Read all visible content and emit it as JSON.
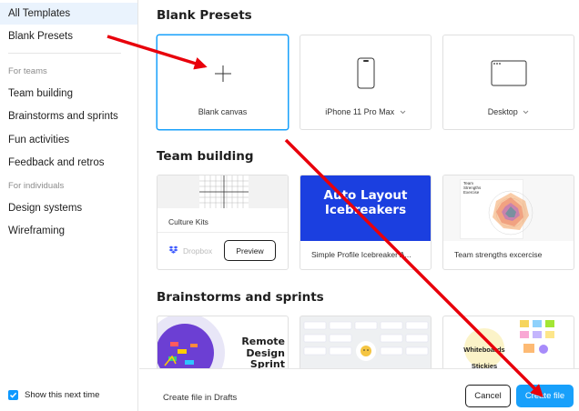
{
  "sidebar": {
    "items": [
      {
        "label": "All Templates"
      },
      {
        "label": "Blank Presets"
      }
    ],
    "section_teams": "For teams",
    "team_items": [
      {
        "label": "Team building"
      },
      {
        "label": "Brainstorms and sprints"
      },
      {
        "label": "Fun activities"
      },
      {
        "label": "Feedback and retros"
      }
    ],
    "section_individuals": "For individuals",
    "individual_items": [
      {
        "label": "Design systems"
      },
      {
        "label": "Wireframing"
      }
    ],
    "show_next_label": "Show this next time",
    "show_next_checked": true
  },
  "main": {
    "blank_presets": {
      "title": "Blank Presets",
      "cards": [
        {
          "label": "Blank canvas"
        },
        {
          "label": "iPhone 11 Pro Max"
        },
        {
          "label": "Desktop"
        }
      ]
    },
    "team_building": {
      "title": "Team building",
      "cards": [
        {
          "label": "Culture Kits",
          "source": "Dropbox",
          "action": "Preview"
        },
        {
          "label": "Simple Profile Icebreaker A...",
          "banner_line1": "Auto Layout",
          "banner_line2": "Icebreakers"
        },
        {
          "label": "Team strengths excercise",
          "mini_title": "Team Strengths Exercise"
        }
      ]
    },
    "brainstorms": {
      "title": "Brainstorms and sprints",
      "cards": [
        {
          "banner_line1": "Remote",
          "banner_line2": "Design",
          "banner_line3": "Sprint"
        },
        {},
        {
          "banner_line1": "Whiteboards",
          "banner_line2": "Stickies"
        }
      ]
    }
  },
  "footer": {
    "label": "Create file in Drafts",
    "cancel": "Cancel",
    "create": "Create file"
  },
  "colors": {
    "accent": "#18a0fb",
    "annotation_arrow": "#e8000b"
  }
}
